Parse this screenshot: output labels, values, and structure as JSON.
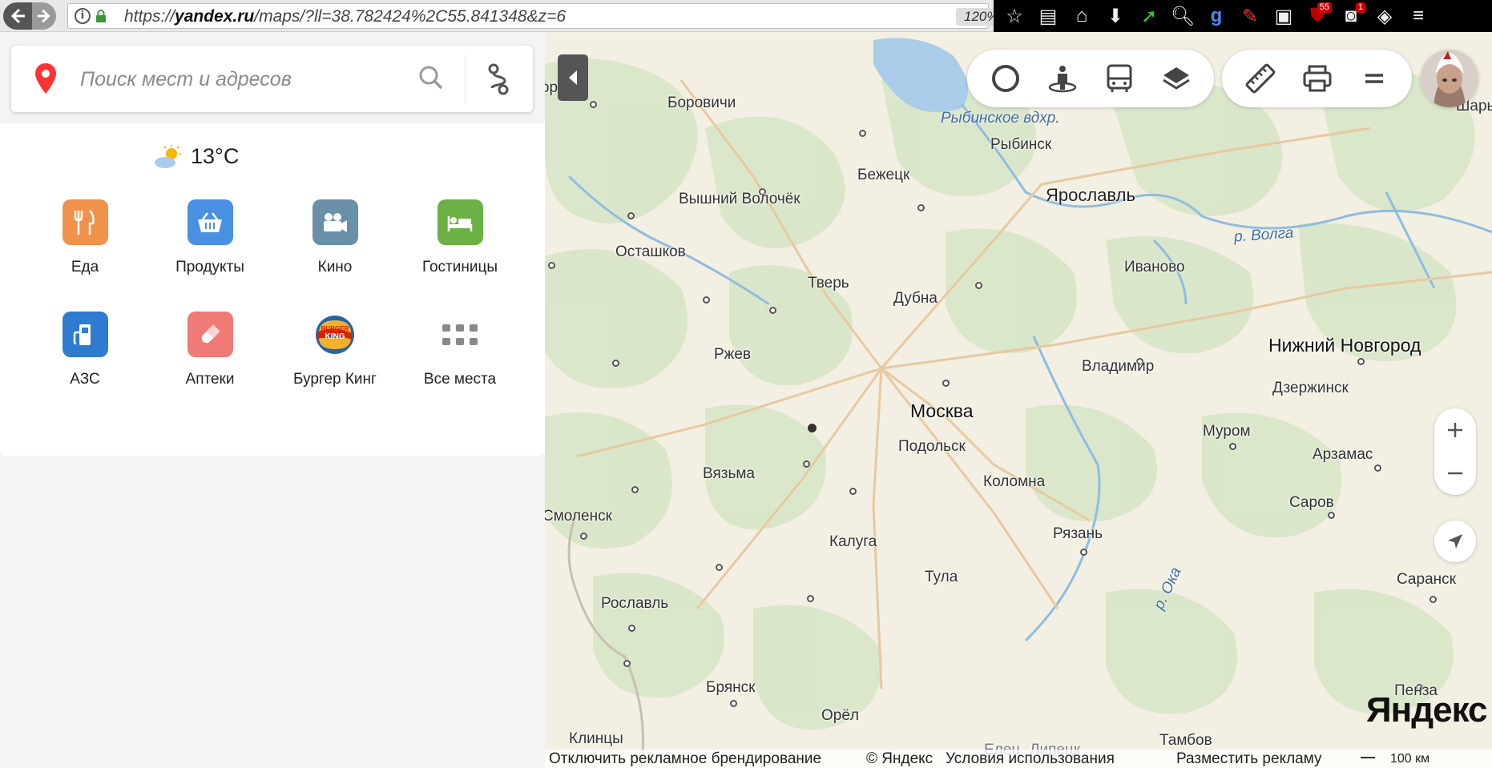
{
  "browser": {
    "url_prefix": "https://",
    "url_host": "yandex.ru",
    "url_rest": "/maps/?ll=38.782424%2C55.841348&z=6",
    "zoom_level": "120%",
    "ublock_count": "55",
    "notif_count": "1",
    "toolbar_icons": [
      "bookmark-star-icon",
      "reading-list-icon",
      "home-icon",
      "download-icon",
      "green-arrow-icon",
      "search-tool-icon",
      "google-icon",
      "pdf-icon",
      "screenshot-icon",
      "ublock-icon",
      "notification-icon",
      "vpn-icon",
      "menu-icon"
    ]
  },
  "search": {
    "placeholder": "Поиск мест и адресов"
  },
  "weather": {
    "temp": "13°C"
  },
  "categories": [
    {
      "label": "Еда",
      "color": "#f0924b",
      "icon": "fork-knife-icon"
    },
    {
      "label": "Продукты",
      "color": "#4a90e2",
      "icon": "basket-icon"
    },
    {
      "label": "Кино",
      "color": "#6a8fa8",
      "icon": "camera-icon"
    },
    {
      "label": "Гостиницы",
      "color": "#6cb146",
      "icon": "bed-icon"
    },
    {
      "label": "АЗС",
      "color": "#2f7bd0",
      "icon": "fuel-icon"
    },
    {
      "label": "Аптеки",
      "color": "#f07a75",
      "icon": "pill-icon"
    },
    {
      "label": "Бургер Кинг",
      "color": "#ffffff",
      "icon": "burger-king-logo"
    },
    {
      "label": "Все места",
      "color": "#ffffff",
      "icon": "grid-dots-icon"
    }
  ],
  "map": {
    "cities": {
      "novgorod": "Новгород",
      "borovichi": "Боровичи",
      "rybinsk": "Рыбинск",
      "sharya": "Шарья",
      "bezhetsk": "Бежецк",
      "vvolochek": "Вышний Волочёк",
      "yaroslavl": "Ярославль",
      "ostashkov": "Осташков",
      "ivanovo": "Иваново",
      "tver": "Тверь",
      "dubna": "Дубна",
      "rzhev": "Ржев",
      "nnovgorod": "Нижний Новгород",
      "vladimir": "Владимир",
      "dzerzhinsk": "Дзержинск",
      "moskva": "Москва",
      "podolsk": "Подольск",
      "murom": "Муром",
      "vyazma": "Вязьма",
      "arzamas": "Арзамас",
      "kolomna": "Коломна",
      "sarov": "Саров",
      "smolensk": "Смоленск",
      "ryazan": "Рязань",
      "kaluga": "Калуга",
      "tula": "Тула",
      "saransk": "Саранск",
      "roslavl": "Рославль",
      "penza": "Пенза",
      "bryansk": "Брянск",
      "orel": "Орёл",
      "klintsy": "Клинцы",
      "tambov": "Тамбов",
      "elets": "Елец",
      "lipetsk": "Липецк"
    },
    "water": {
      "rybinsk_res": "Рыбинское вдхр.",
      "volga": "р. Волга",
      "oka": "р. Ока"
    },
    "logo": "Яндекс",
    "footer": {
      "disable_branding": "Отключить рекламное брендирование",
      "copyright": "© Яндекс",
      "terms": "Условия использования",
      "advertise": "Разместить рекламу",
      "scale": "100 км"
    },
    "colors": {
      "land": "#f3efe2",
      "forest": "#d9e6c8",
      "water": "#a9cce8",
      "road": "#e8c9a0"
    }
  }
}
